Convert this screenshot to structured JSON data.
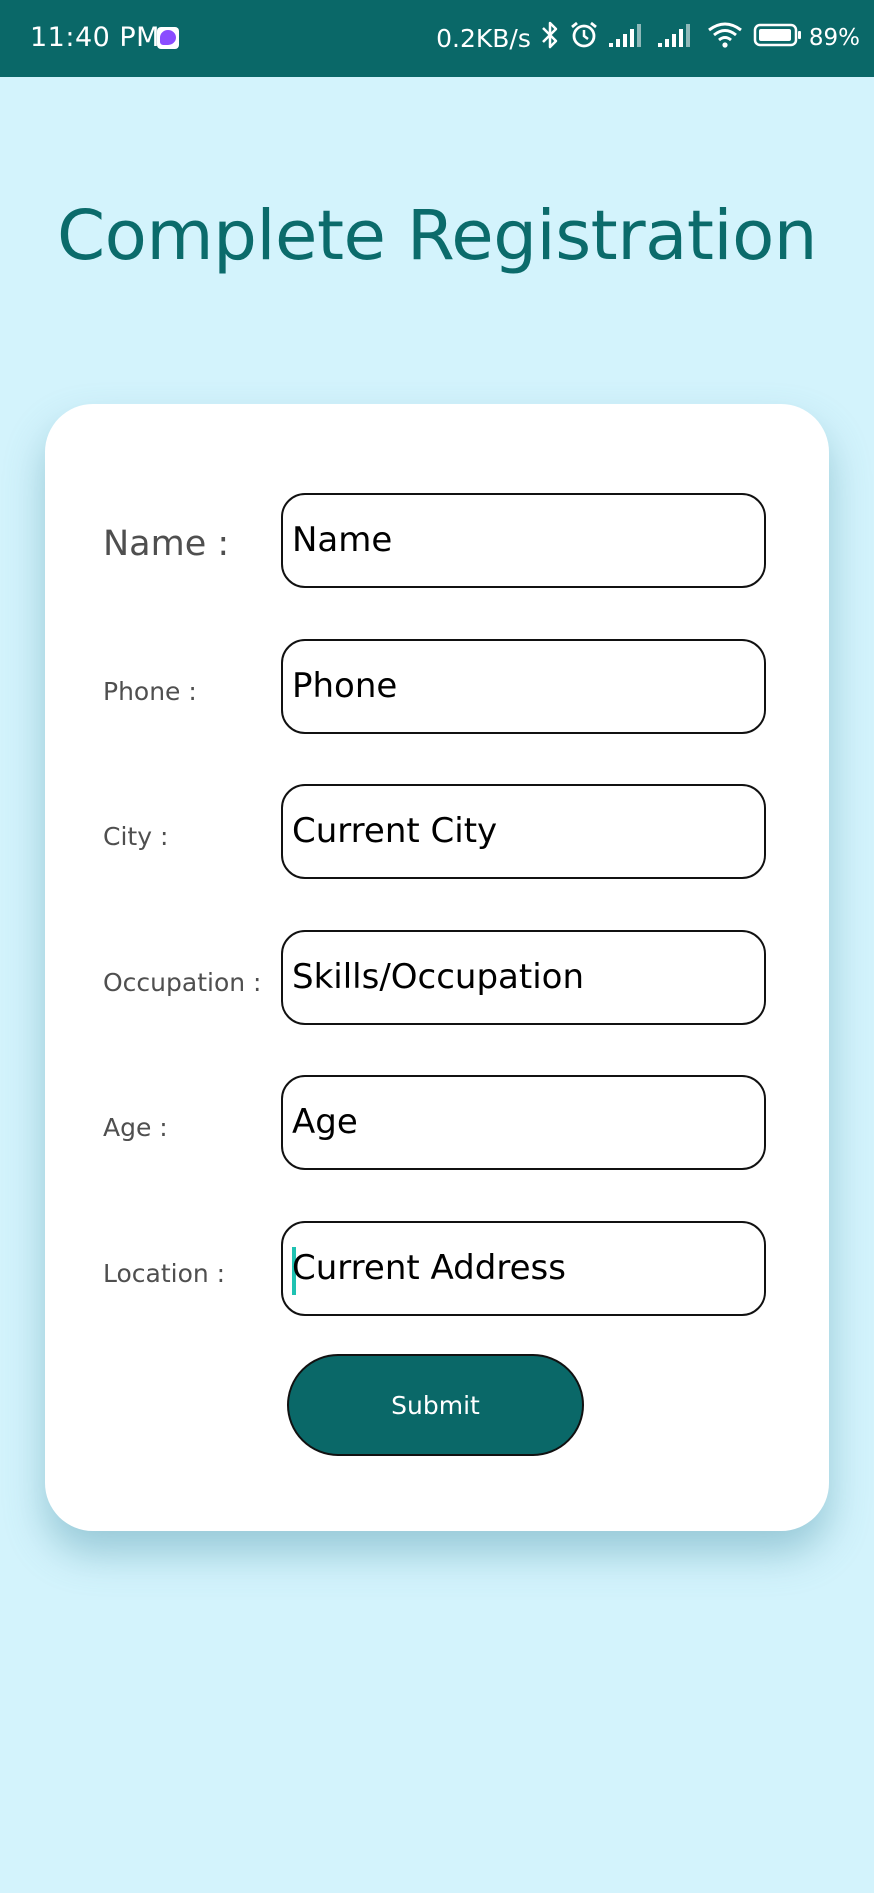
{
  "status_bar": {
    "time": "11:40 PM",
    "net_speed": "0.2KB/s",
    "battery": "89%",
    "background": "#0a6868",
    "icons": [
      "messenger-icon",
      "bluetooth-icon",
      "alarm-icon",
      "signal-icon",
      "signal-icon",
      "wifi-icon",
      "battery-icon"
    ]
  },
  "page": {
    "title": "Complete Registration",
    "background": "#d3f3fc",
    "accent": "#0a6868"
  },
  "form": {
    "fields": [
      {
        "label": "Name :",
        "placeholder": "Name"
      },
      {
        "label": "Phone :",
        "placeholder": "Phone"
      },
      {
        "label": "City :",
        "placeholder": "Current City"
      },
      {
        "label": "Occupation :",
        "placeholder": "Skills/Occupation"
      },
      {
        "label": "Age :",
        "placeholder": "Age"
      },
      {
        "label": "Location :",
        "placeholder": "Current Address"
      }
    ],
    "submit_label": "Submit"
  }
}
